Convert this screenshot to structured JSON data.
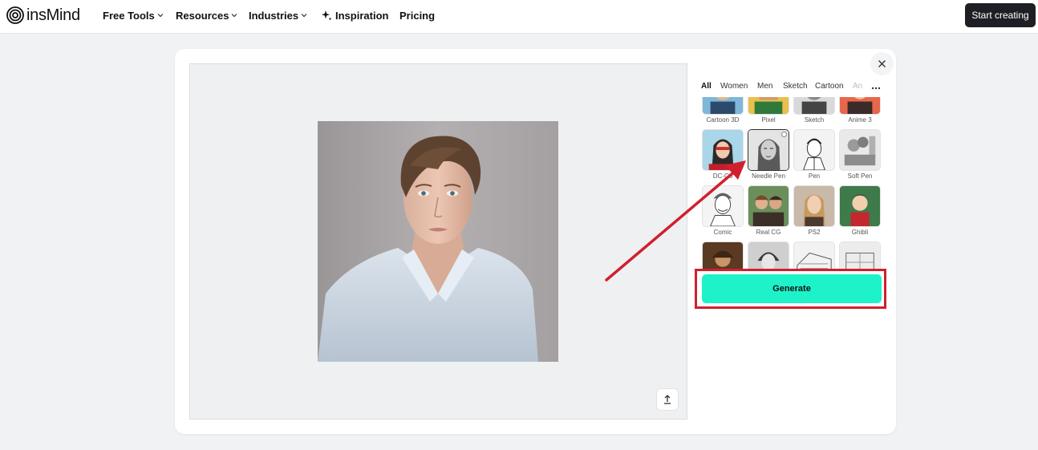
{
  "nav": {
    "logo_text": "insMind",
    "items": [
      {
        "label": "Free Tools",
        "has_menu": true
      },
      {
        "label": "Resources",
        "has_menu": true
      },
      {
        "label": "Industries",
        "has_menu": true
      },
      {
        "label": "Inspiration",
        "icon": "sparkle-icon"
      },
      {
        "label": "Pricing"
      }
    ],
    "cta": "Start creating"
  },
  "filters": {
    "tabs": [
      "All",
      "Women",
      "Men",
      "Sketch",
      "Cartoon",
      "An"
    ],
    "active": "All"
  },
  "styles": [
    {
      "label": "Cartoon 3D"
    },
    {
      "label": "Pixel"
    },
    {
      "label": "Sketch"
    },
    {
      "label": "Anime 3"
    },
    {
      "label": "DC-Co"
    },
    {
      "label": "Needle Pen",
      "selected": true
    },
    {
      "label": "Pen"
    },
    {
      "label": "Soft Pen"
    },
    {
      "label": "Comic"
    },
    {
      "label": "Real CG"
    },
    {
      "label": "PS2"
    },
    {
      "label": "Ghibli"
    },
    {
      "label": ""
    },
    {
      "label": ""
    },
    {
      "label": ""
    },
    {
      "label": ""
    }
  ],
  "generate_label": "Generate",
  "colors": {
    "accent": "#1ef2c9",
    "highlight": "#d0202e",
    "cta_bg": "#1d1f24"
  }
}
